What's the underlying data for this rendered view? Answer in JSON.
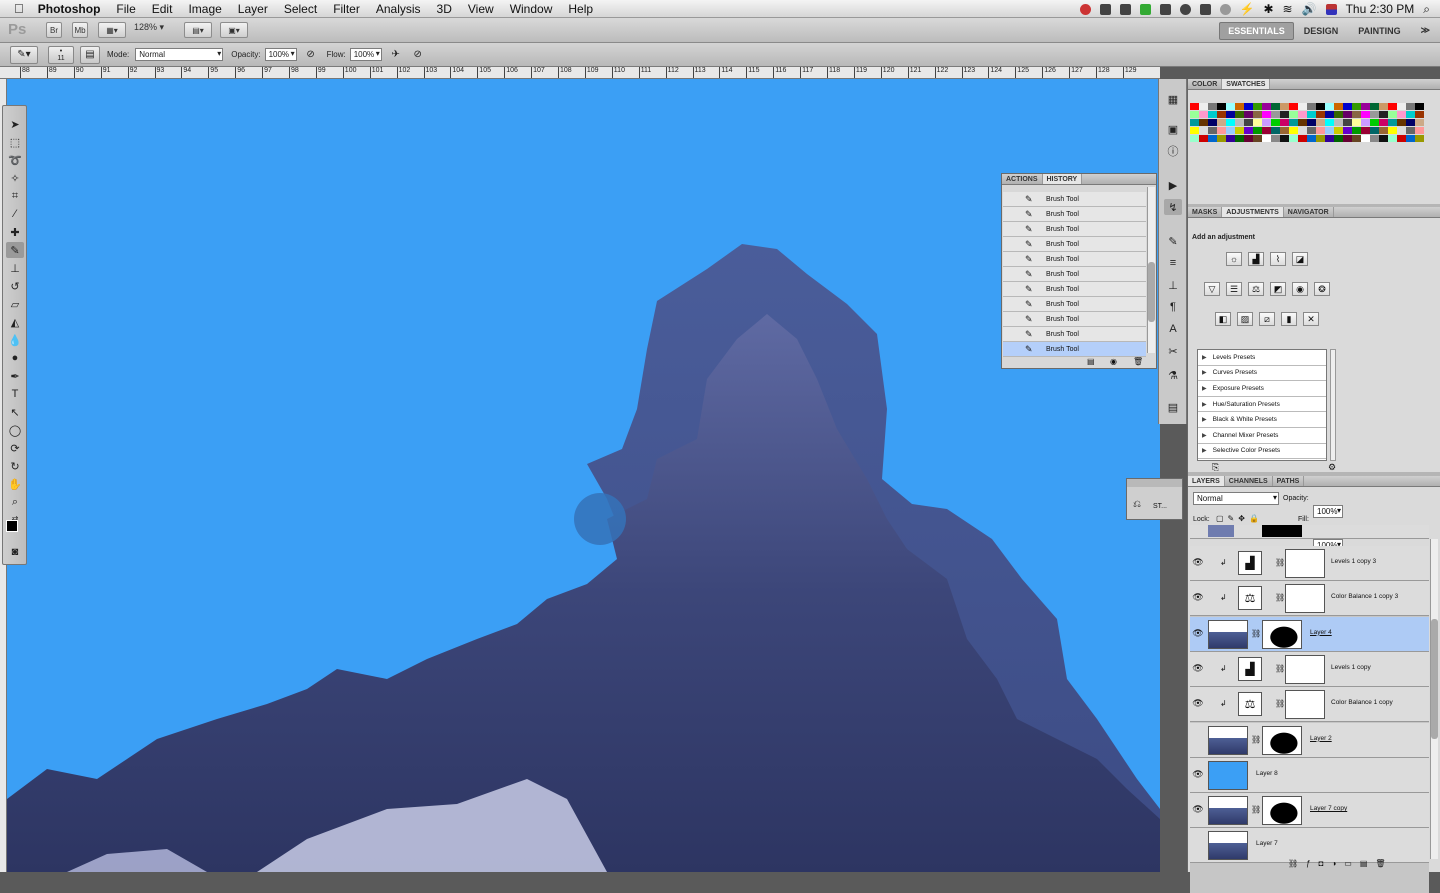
{
  "menubar": {
    "apple": "",
    "app": "Photoshop",
    "items": [
      "File",
      "Edit",
      "Image",
      "Layer",
      "Select",
      "Filter",
      "Analysis",
      "3D",
      "View",
      "Window",
      "Help"
    ],
    "clock": "Thu 2:30 PM",
    "search_icon": "magnifier-icon"
  },
  "appbar": {
    "logo": "Ps",
    "br": "Br",
    "mb": "Mb",
    "zoom": "128%"
  },
  "workspaces": {
    "items": [
      "ESSENTIALS",
      "DESIGN",
      "PAINTING"
    ],
    "more": "≫"
  },
  "options": {
    "brush_size": "11",
    "mode_label": "Mode:",
    "mode": "Normal",
    "opacity_label": "Opacity:",
    "opacity": "100%",
    "flow_label": "Flow:",
    "flow": "100%"
  },
  "ruler": {
    "ticks": [
      "88",
      "89",
      "90",
      "91",
      "92",
      "93",
      "94",
      "95",
      "96",
      "97",
      "98",
      "99",
      "100",
      "101",
      "102",
      "103",
      "104",
      "105",
      "106",
      "107",
      "108",
      "109",
      "110",
      "111",
      "112",
      "113",
      "114",
      "115",
      "116",
      "117",
      "118",
      "119",
      "120",
      "121",
      "122",
      "123",
      "124",
      "125",
      "126",
      "127",
      "128",
      "129"
    ]
  },
  "panels": {
    "color": {
      "tabs": [
        "COLOR",
        "SWATCHES"
      ]
    },
    "adjustments": {
      "tabs": [
        "MASKS",
        "ADJUSTMENTS",
        "NAVIGATOR"
      ],
      "title": "Add an adjustment",
      "presets": [
        "Levels Presets",
        "Curves Presets",
        "Exposure Presets",
        "Hue/Saturation Presets",
        "Black & White Presets",
        "Channel Mixer Presets",
        "Selective Color Presets"
      ]
    },
    "history": {
      "tabs": [
        "ACTIONS",
        "HISTORY"
      ],
      "items": [
        "Brush Tool",
        "Brush Tool",
        "Brush Tool",
        "Brush Tool",
        "Brush Tool",
        "Brush Tool",
        "Brush Tool",
        "Brush Tool",
        "Brush Tool",
        "Brush Tool",
        "Brush Tool"
      ],
      "selected": "Brush Tool"
    },
    "styles": {
      "label": "ST..."
    },
    "layers": {
      "tabs": [
        "LAYERS",
        "CHANNELS",
        "PATHS"
      ],
      "blend": "Normal",
      "opacity_label": "Opacity:",
      "opacity": "100%",
      "lock_label": "Lock:",
      "fill_label": "Fill:",
      "fill": "100%",
      "rows": [
        {
          "name": "Levels 1 copy 3",
          "type": "adj"
        },
        {
          "name": "Color Balance 1 copy 3",
          "type": "adj"
        },
        {
          "name": "Layer 4",
          "type": "masked",
          "selected": true
        },
        {
          "name": "Levels 1 copy",
          "type": "adj"
        },
        {
          "name": "Color Balance 1 copy",
          "type": "adj"
        },
        {
          "name": "Layer 2",
          "type": "masked"
        },
        {
          "name": "Layer 8",
          "type": "fill"
        },
        {
          "name": "Layer 7 copy",
          "type": "masked"
        },
        {
          "name": "Layer 7",
          "type": "plain"
        }
      ]
    }
  },
  "colors": {
    "canvas": "#3b9ff5",
    "selection": "#aecbf5"
  }
}
